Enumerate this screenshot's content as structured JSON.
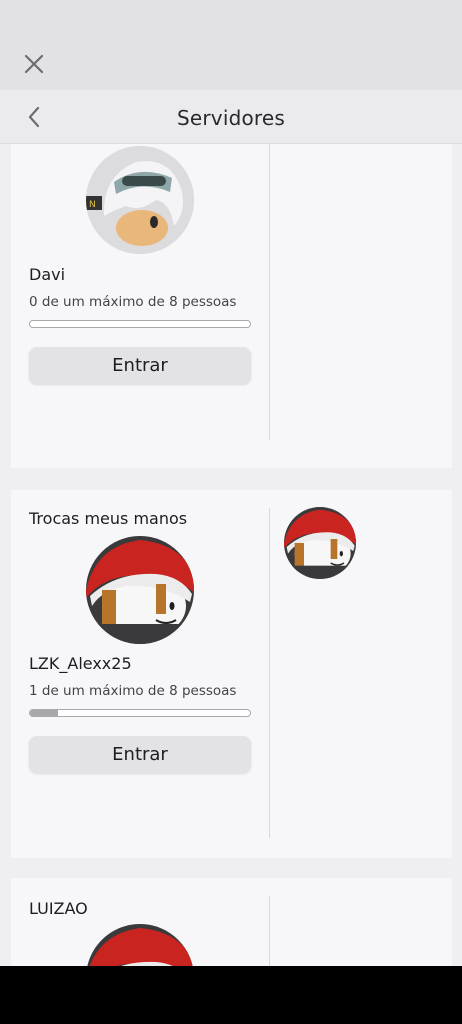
{
  "header": {
    "title": "Servidores"
  },
  "icons": {
    "close": "close-icon",
    "back": "chevron-left-icon"
  },
  "servers": [
    {
      "name": "",
      "owner": "Davi",
      "capacity": "0 de um máximo de 8 pessoas",
      "players": 0,
      "max_players": 8,
      "join_label": "Entrar",
      "avatar": "white-hair-goggles-avatar"
    },
    {
      "name": "Trocas meus manos",
      "owner": "LZK_Alexx25",
      "capacity": "1 de um máximo de 8 pessoas",
      "players": 1,
      "max_players": 8,
      "join_label": "Entrar",
      "avatar": "santa-hat-avatar"
    },
    {
      "name": "LUIZAO",
      "avatar": "santa-hat-avatar"
    }
  ]
}
